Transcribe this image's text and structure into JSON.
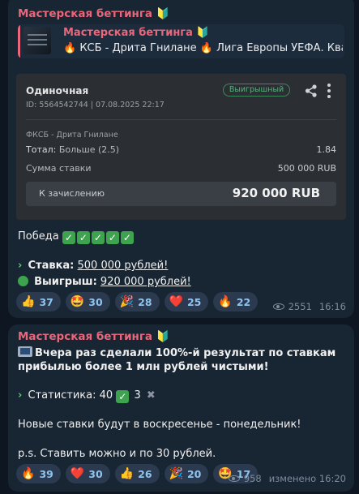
{
  "channel_name": "Мастерская беттинга",
  "badge_emoji": "🔰",
  "message1": {
    "reply": {
      "title": "Мастерская беттинга",
      "badge": "🔰",
      "text": "🔥 КСБ - Дрита Гнилане 🔥 Лига Европы УЕФА. Квалиф…"
    },
    "bet_card": {
      "type": "Одиночная",
      "id_line": "ID: 5564542744  |  07.08.2025 22:17",
      "status": "Выигрышный",
      "event": "ФКСБ - Дрита Гнилане",
      "total_label": "Тотал:",
      "total_pick": "Больше (2.5)",
      "odds": "1.84",
      "stake_label": "Сумма ставки",
      "stake_value": "500 000 RUB",
      "payout_label": "К зачислению",
      "payout_value": "920 000  RUB"
    },
    "win_line": "Победа",
    "stake_label": "Ставка:",
    "stake_value": "500 000 рублей!",
    "win_label": "Выигрыш:",
    "win_value": "920 000 рублей!",
    "reactions": [
      {
        "emoji": "👍",
        "count": "37"
      },
      {
        "emoji": "🤩",
        "count": "30"
      },
      {
        "emoji": "🎉",
        "count": "28"
      },
      {
        "emoji": "❤️",
        "count": "25"
      },
      {
        "emoji": "🔥",
        "count": "22"
      }
    ],
    "views": "2551",
    "time": "16:16"
  },
  "message2": {
    "headline_1": "Вчера раз сделали 100%-й результат по ставкам",
    "headline_2": "прибылью более 1 млн рублей чистыми!",
    "stats_label": "Статистика: 40",
    "stats_losses": "3",
    "schedule": "Новые ставки будут в воскресенье - понедельник!",
    "ps": "p.s. Ставить можно и по 30 рублей.",
    "reactions": [
      {
        "emoji": "🔥",
        "count": "39"
      },
      {
        "emoji": "❤️",
        "count": "30"
      },
      {
        "emoji": "👍",
        "count": "26"
      },
      {
        "emoji": "🎉",
        "count": "20"
      },
      {
        "emoji": "🤩",
        "count": "17"
      }
    ],
    "views": "958",
    "time": "изменено 16:20"
  }
}
